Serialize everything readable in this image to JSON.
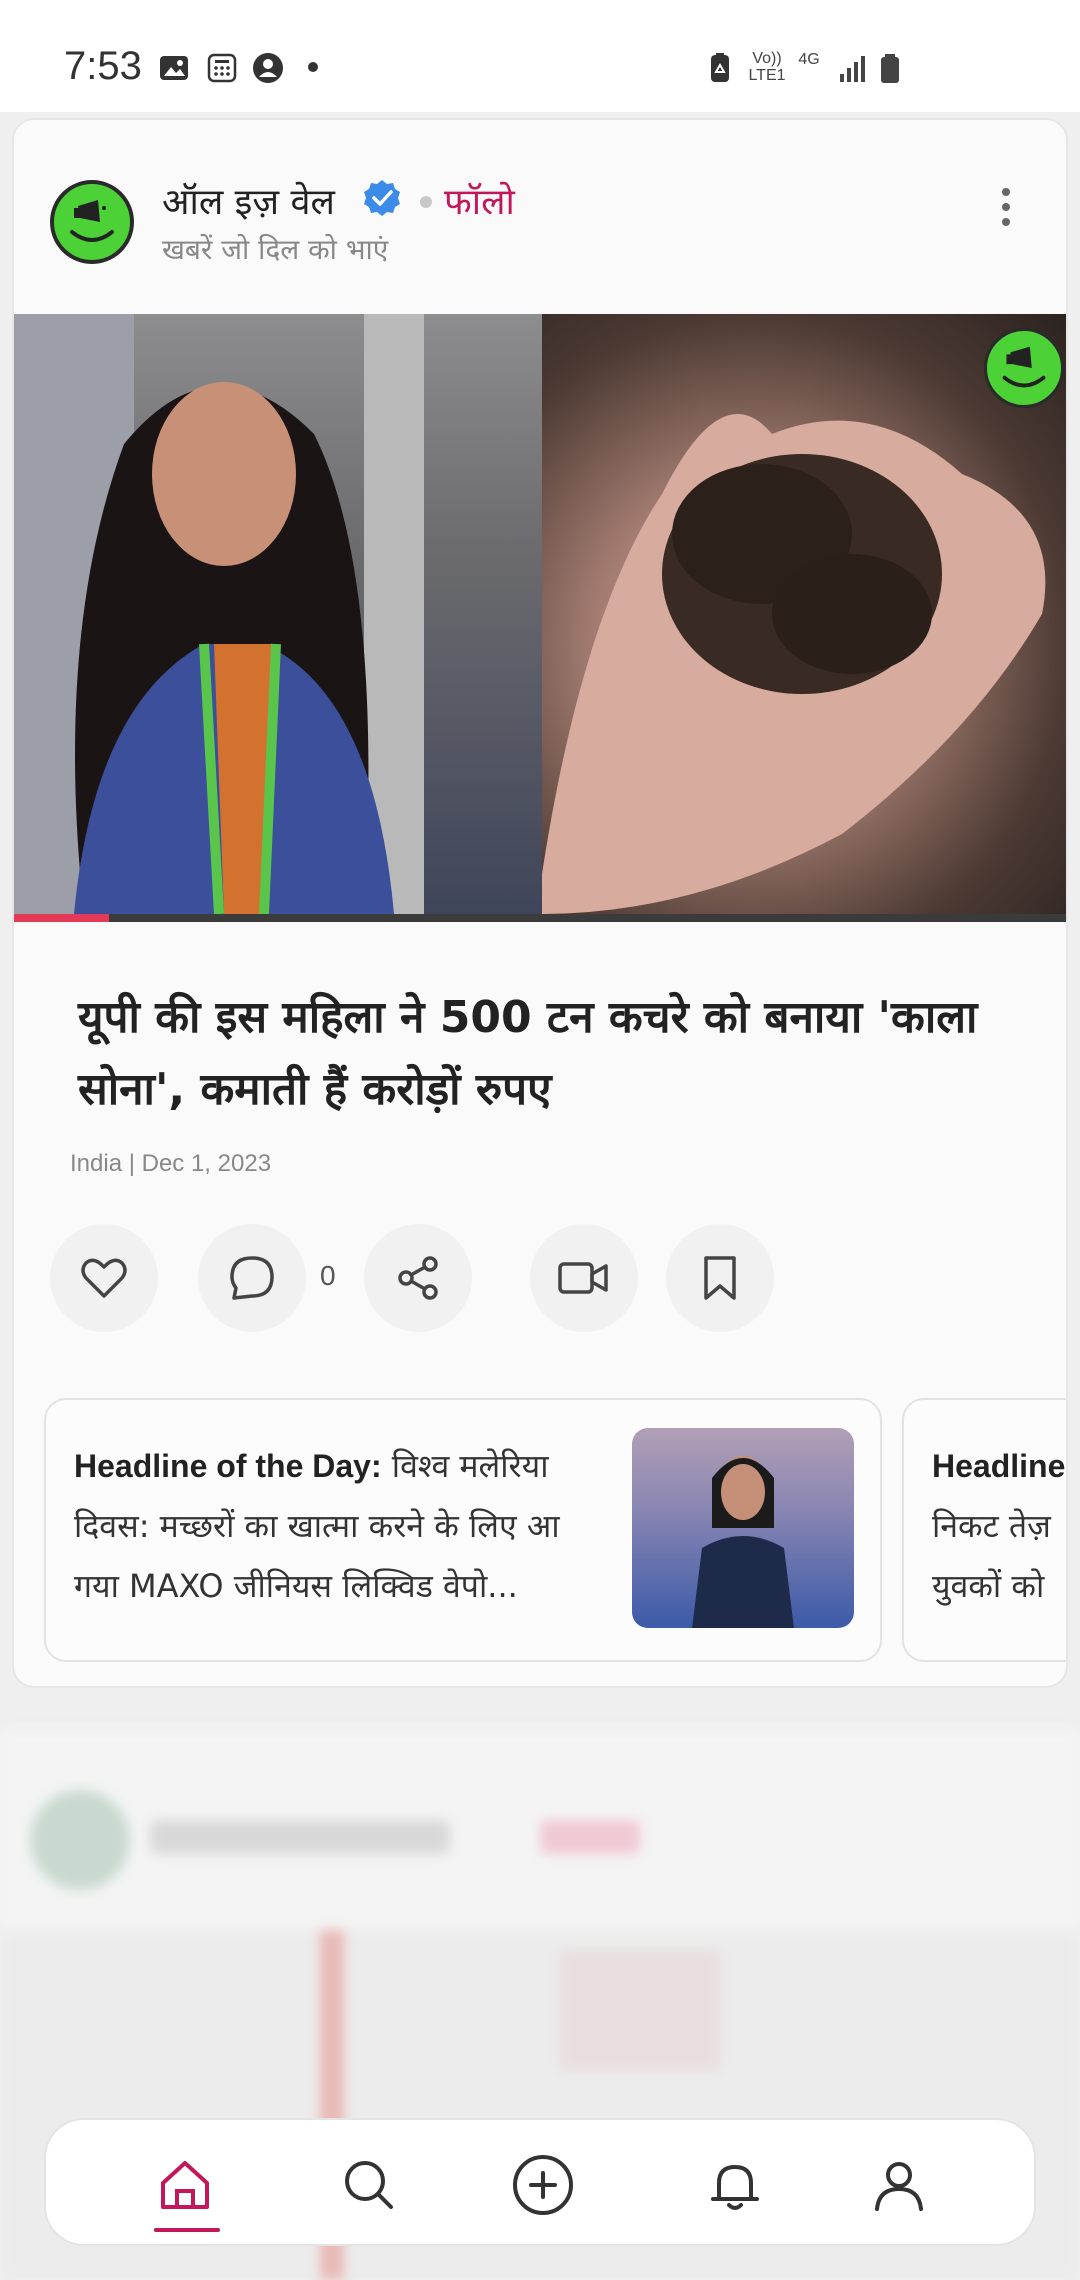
{
  "status_bar": {
    "time": "7:53",
    "network_labels": [
      "Vo)) LTE1",
      "4G"
    ],
    "icons": [
      "image-icon",
      "calculator-icon",
      "account-icon",
      "dot-icon",
      "recycle-icon",
      "volte-icon",
      "4g-icon",
      "signal-icon",
      "battery-icon"
    ]
  },
  "post": {
    "channel_name": "ऑल इज़ वेल",
    "verified": true,
    "follow_label": "फॉलो",
    "tagline": "खबरें जो दिल को भाएं",
    "video_progress": 0.09,
    "headline": "यूपी की इस महिला ने 500 टन कचरे को बनाया 'काला सोना', कमाती हैं करोड़ों रुपए",
    "meta": "India | Dec 1, 2023",
    "comment_count": "0",
    "actions": [
      "heart-icon",
      "comment-icon",
      "share-icon",
      "video-icon",
      "bookmark-icon"
    ]
  },
  "headline_cards": [
    {
      "label": "Headline of the Day:",
      "text": " विश्व मलेरिया दिवस: मच्छरों का खात्मा करने के लिए आ गया MAXO जीनियस लिक्विड वेपो..."
    },
    {
      "label": "Headline",
      "text": "निकट तेज़ युवकों को"
    }
  ],
  "colors": {
    "accent": "#c2185b",
    "brand_green": "#4cd137",
    "verified_blue": "#3d8be8",
    "progress": "#e53958"
  },
  "bottom_nav": {
    "items": [
      "home-icon",
      "search-icon",
      "add-icon",
      "bell-icon",
      "profile-icon"
    ],
    "active": "home-icon"
  }
}
